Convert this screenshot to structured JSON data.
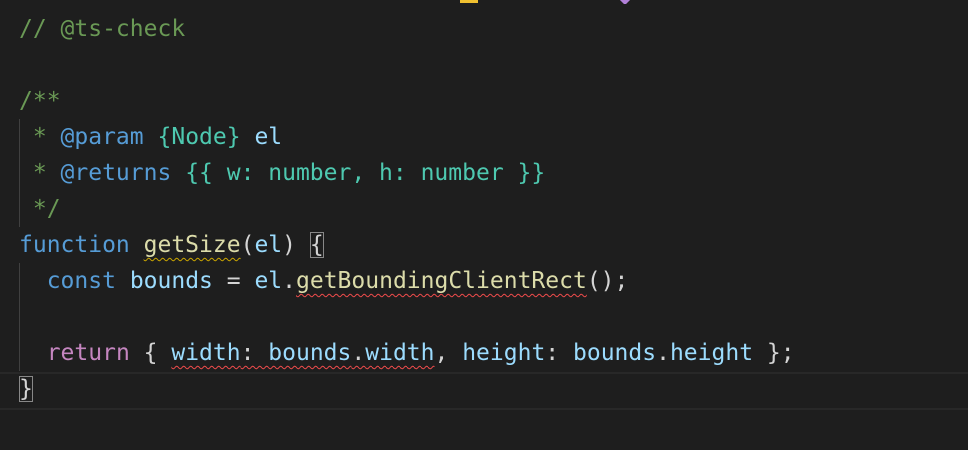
{
  "editor": {
    "lines": [
      [
        "// @ts-check"
      ],
      [
        ""
      ],
      [
        "/**"
      ],
      [
        " * ",
        "@param",
        " ",
        "{Node}",
        " ",
        "el"
      ],
      [
        " * ",
        "@returns",
        " ",
        "{{ w: number, h: number }}"
      ],
      [
        " */"
      ],
      [
        "function",
        " ",
        "getSize",
        "(",
        "el",
        ") ",
        "{"
      ],
      [
        "  ",
        "const",
        " ",
        "bounds",
        " = ",
        "el",
        ".",
        "getBoundingClientRect",
        "();"
      ],
      [
        ""
      ],
      [
        "  ",
        "return",
        " { ",
        "width",
        ": ",
        "bounds",
        ".",
        "width",
        ", ",
        "height",
        ": ",
        "bounds",
        ".",
        "height",
        " };"
      ],
      [
        "}"
      ]
    ]
  },
  "colors": {
    "background": "#1e1e1e",
    "comment": "#6a9955",
    "keyword": "#569cd6",
    "control": "#c586c0",
    "function": "#dcdcaa",
    "variable": "#9cdcfe",
    "type": "#4ec9b0",
    "error_squiggle": "#f14c4c",
    "warning_squiggle": "#cca700"
  }
}
